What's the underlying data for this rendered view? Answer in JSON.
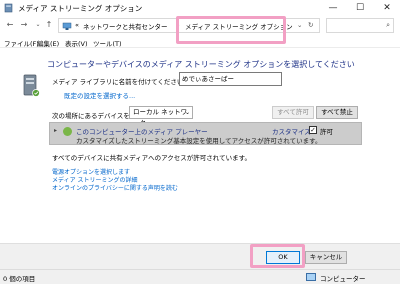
{
  "window": {
    "title": "メディア ストリーミング オプション",
    "minimize": "—",
    "maximize": "☐",
    "close": "✕"
  },
  "address_bar": {
    "back": "←",
    "forward": "→",
    "up": "↑",
    "crumb_prefix": "«",
    "crumb_1": "ネットワークと共有センター",
    "separator": "›",
    "crumb_2": "メディア ストリーミング オプション",
    "search_placeholder": ""
  },
  "menu": {
    "file": "ファイル(F)",
    "edit": "編集(E)",
    "view": "表示(V)",
    "tools": "ツール(T)"
  },
  "main": {
    "heading": "コンピューターやデバイスのメディア ストリーミング オプションを選択してください",
    "library_name_label": "メディア ライブラリに名前を付けてください:",
    "library_name_value": "めでぃあさーばー",
    "default_settings_link": "既定の設定を選択する...",
    "show_devices_label": "次の場所にあるデバイスを表示:",
    "network_selected": "ローカル ネットワーク",
    "allow_all_button": "すべて許可",
    "block_all_button": "すべて禁止",
    "device": {
      "expander": "▸",
      "name": "このコンピューター上のメディア プレーヤー",
      "description": "カスタマイズしたストリーミング基本設定を使用してアクセスが許可されています。",
      "customize_link": "カスタマイズ...",
      "allowed_checked": "✓",
      "allowed_label": "許可"
    },
    "all_allowed_message": "すべてのデバイスに共有メディアへのアクセスが許可されています。",
    "links": [
      "電源オプションを選択します",
      "メディア ストリーミングの詳細",
      "オンラインのプライバシーに関する声明を読む"
    ]
  },
  "footer": {
    "ok_button": "OK",
    "cancel_button": "キャンセル"
  },
  "status_bar": {
    "item_count": "0 個の項目",
    "location": "コンピューター"
  },
  "colors": {
    "heading": "#1e3287",
    "link": "#0066cc",
    "highlight": "#f2a0c4",
    "device_bg": "#cccccc"
  }
}
